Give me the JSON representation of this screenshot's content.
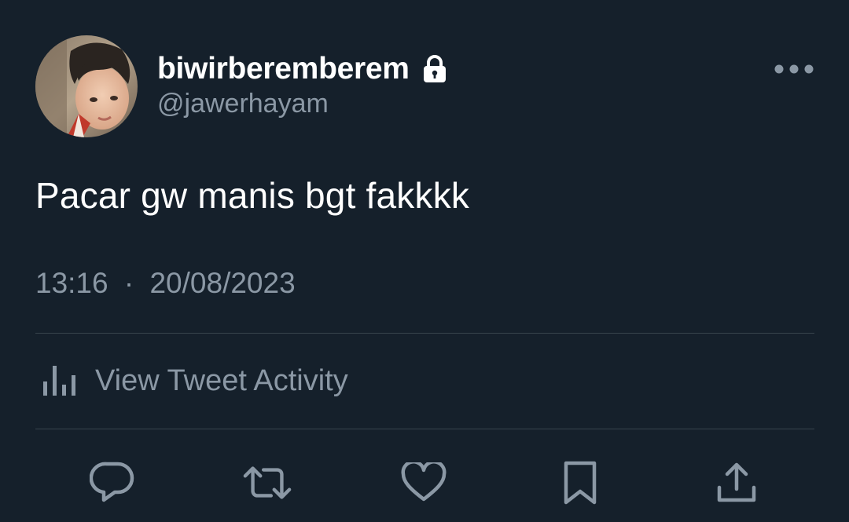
{
  "tweet": {
    "display_name": "biwirberemberem",
    "handle": "@jawerhayam",
    "protected": true,
    "text": "Pacar gw manis bgt fakkkk",
    "time": "13:16",
    "separator": "·",
    "date": "20/08/2023"
  },
  "activity": {
    "label": "View Tweet Activity",
    "icon": "analytics-bars-icon"
  },
  "actions": {
    "reply_icon": "reply-icon",
    "retweet_icon": "retweet-icon",
    "like_icon": "heart-icon",
    "bookmark_icon": "bookmark-icon",
    "share_icon": "share-icon"
  },
  "colors": {
    "background": "#15202b",
    "primary_text": "#ffffff",
    "secondary_text": "#8b98a5",
    "divider": "#38444d"
  }
}
